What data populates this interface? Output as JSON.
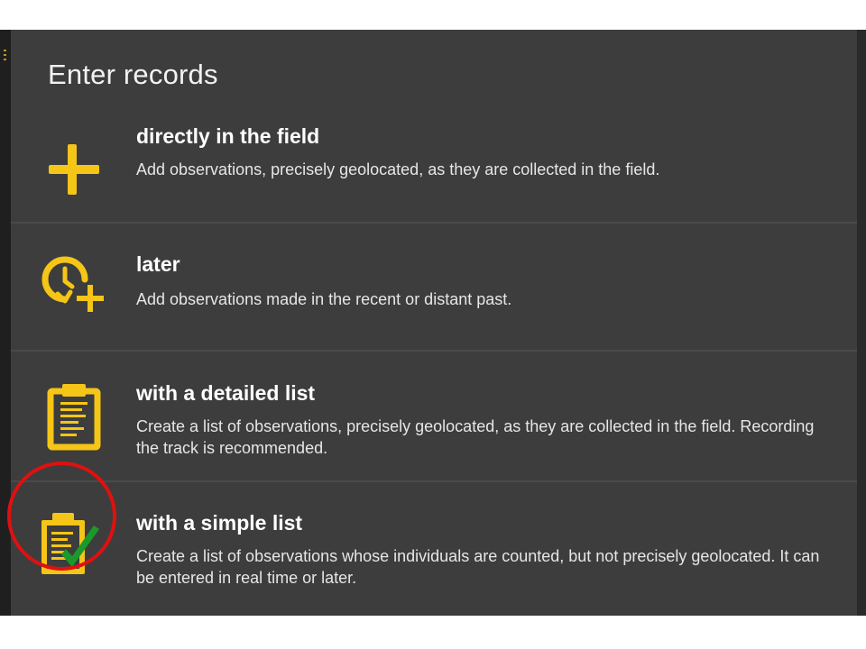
{
  "dialog": {
    "title": "Enter records"
  },
  "options": [
    {
      "title": "directly in the field",
      "description": "Add observations, precisely geolocated, as they are collected in the field.",
      "icon": "plus-icon"
    },
    {
      "title": "later",
      "description": "Add observations made in the recent or distant past.",
      "icon": "clock-plus-icon"
    },
    {
      "title": "with a detailed list",
      "description": "Create a list of observations, precisely geolocated, as they are collected in the field. Recording the track is recommended.",
      "icon": "clipboard-list-icon"
    },
    {
      "title": "with a simple list",
      "description": "Create a list of observations whose individuals are counted, but not precisely geolocated. It can be entered in real time or later.",
      "icon": "clipboard-check-icon"
    }
  ],
  "annotation": {
    "highlighted_option": "with a simple list",
    "highlight_color": "#e01010"
  },
  "colors": {
    "accent": "#f5c518",
    "check": "#1a9a2a",
    "background": "#3d3d3d",
    "divider": "#4a4a4a"
  }
}
